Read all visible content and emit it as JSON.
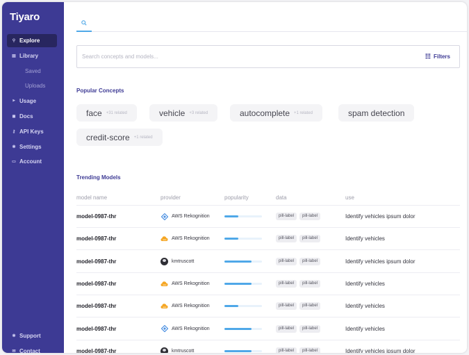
{
  "app": {
    "name": "Tiyaro"
  },
  "sidebar": {
    "items": [
      {
        "label": "Explore",
        "icon": "search-icon",
        "glyph": "⚲",
        "active": true,
        "sub": false
      },
      {
        "label": "Library",
        "icon": "library-icon",
        "glyph": "▤",
        "active": false,
        "sub": false
      },
      {
        "label": "Saved",
        "icon": "",
        "glyph": "",
        "active": false,
        "sub": true
      },
      {
        "label": "Uploads",
        "icon": "",
        "glyph": "",
        "active": false,
        "sub": true
      },
      {
        "label": "Usage",
        "icon": "usage-icon",
        "glyph": "⫸",
        "active": false,
        "sub": false
      },
      {
        "label": "Docs",
        "icon": "docs-icon",
        "glyph": "◼",
        "active": false,
        "sub": false
      },
      {
        "label": "API Keys",
        "icon": "key-icon",
        "glyph": "⚷",
        "active": false,
        "sub": false
      },
      {
        "label": "Settings",
        "icon": "gear-icon",
        "glyph": "✱",
        "active": false,
        "sub": false
      },
      {
        "label": "Account",
        "icon": "account-icon",
        "glyph": "▭",
        "active": false,
        "sub": false
      }
    ],
    "bottom_items": [
      {
        "label": "Support",
        "icon": "support-icon",
        "glyph": "✱"
      },
      {
        "label": "Contact",
        "icon": "contact-icon",
        "glyph": "✉"
      }
    ]
  },
  "search": {
    "placeholder": "Search concepts and models...",
    "value": "",
    "filters_label": "Filters"
  },
  "popular_concepts": {
    "title": "Popular Concepts",
    "items": [
      {
        "name": "face",
        "related": "+31 related"
      },
      {
        "name": "vehicle",
        "related": "+3 related"
      },
      {
        "name": "autocomplete",
        "related": "+1 related"
      },
      {
        "name": "spam detection",
        "related": ""
      },
      {
        "name": "credit-score",
        "related": "+1 related"
      }
    ]
  },
  "trending_models": {
    "title": "Trending Models",
    "columns": [
      "model name",
      "provider",
      "popularity",
      "data",
      "use"
    ],
    "rows": [
      {
        "model": "model-0987-thr",
        "provider": "AWS Rekognition",
        "provider_icon": "diamond-icon",
        "popularity": 0.37,
        "pills": [
          "pill-label",
          "pill-label"
        ],
        "use": "Identify vehicles ipsum dolor"
      },
      {
        "model": "model-0987-thr",
        "provider": "AWS Rekognition",
        "provider_icon": "cloud-icon",
        "popularity": 0.37,
        "pills": [
          "pill-label",
          "pill-label"
        ],
        "use": "Identify vehicles"
      },
      {
        "model": "model-0987-thr",
        "provider": "kmtruscott",
        "provider_icon": "avatar-icon",
        "popularity": 0.72,
        "pills": [
          "pill-label",
          "pill-label"
        ],
        "use": "Identify vehicles ipsum dolor"
      },
      {
        "model": "model-0987-thr",
        "provider": "AWS Rekognition",
        "provider_icon": "cloud-icon",
        "popularity": 0.72,
        "pills": [
          "pill-label",
          "pill-label"
        ],
        "use": "Identify vehicles"
      },
      {
        "model": "model-0987-thr",
        "provider": "AWS Rekognition",
        "provider_icon": "cloud-icon",
        "popularity": 0.37,
        "pills": [
          "pill-label",
          "pill-label"
        ],
        "use": "Identify vehicles"
      },
      {
        "model": "model-0987-thr",
        "provider": "AWS Rekognition",
        "provider_icon": "diamond-icon",
        "popularity": 0.72,
        "pills": [
          "pill-label",
          "pill-label"
        ],
        "use": "Identify vehicles"
      },
      {
        "model": "model-0987-thr",
        "provider": "kmtruscott",
        "provider_icon": "avatar-icon",
        "popularity": 0.72,
        "pills": [
          "pill-label",
          "pill-label"
        ],
        "use": "Identify vehicles ipsum dolor"
      }
    ]
  },
  "colors": {
    "sidebar": "#3d3a94",
    "sidebar_active": "#28265f",
    "accent": "#4fa8e8",
    "heading": "#3d3a94",
    "aws_diamond": "#4a90e2",
    "aws_cloud": "#f5a623"
  }
}
